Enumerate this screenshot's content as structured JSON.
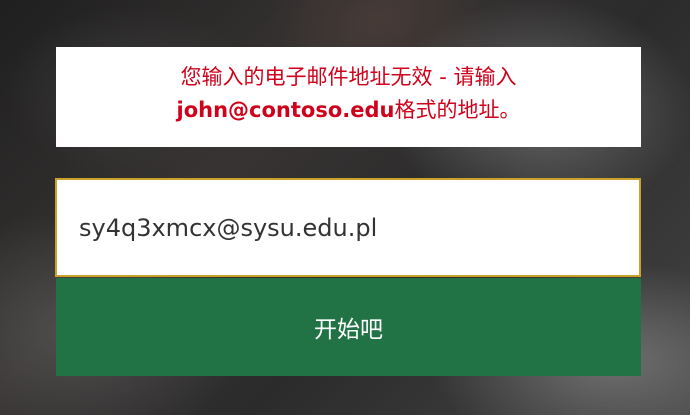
{
  "error": {
    "line1": "您输入的电子邮件地址无效 - 请输入",
    "line2_email": "john@contoso.edu",
    "line2_suffix": "格式的地址。",
    "color": "#d0021b"
  },
  "email_input": {
    "value": "sy4q3xmcx@sysu.edu.pl"
  },
  "start_button": {
    "label": "开始吧",
    "color": "#217346"
  }
}
